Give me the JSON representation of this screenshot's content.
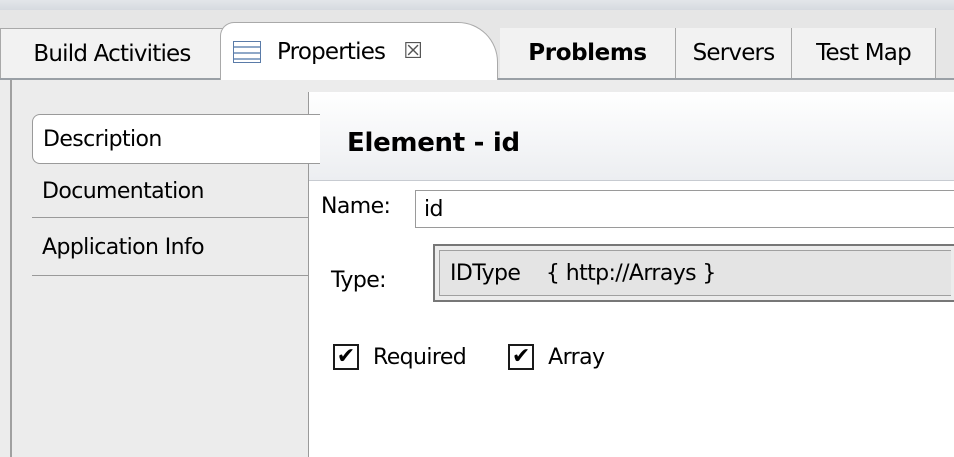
{
  "tabs": {
    "build": "Build Activities",
    "properties": "Properties",
    "properties_close": "☒",
    "problems": "Problems",
    "servers": "Servers",
    "test_map": "Test Map",
    "active": "Properties"
  },
  "sidebar": {
    "items": [
      {
        "label": "Description",
        "selected": true
      },
      {
        "label": "Documentation",
        "selected": false
      },
      {
        "label": "Application Info",
        "selected": false
      }
    ]
  },
  "header": {
    "title": "Element - id"
  },
  "form": {
    "name_label": "Name:",
    "name_value": "id",
    "type_label": "Type:",
    "type_value": "IDType    { http://Arrays }",
    "required_label": "Required",
    "required_checked": true,
    "array_label": "Array",
    "array_checked": true,
    "check_mark": "✔"
  }
}
